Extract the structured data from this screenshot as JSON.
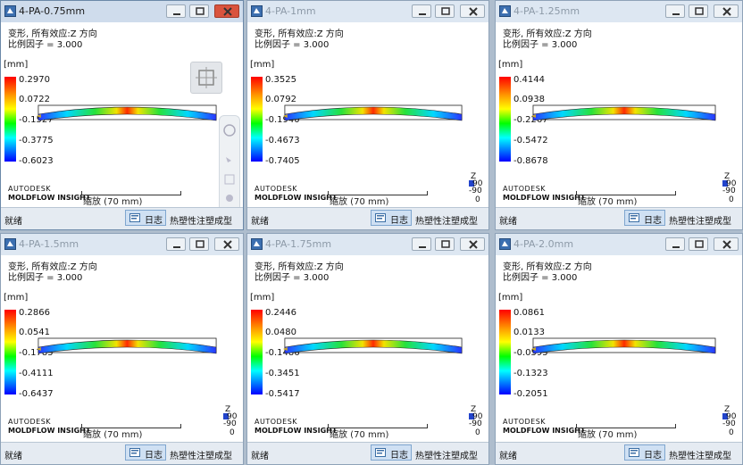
{
  "colors": {
    "accent": "#cfe0f3",
    "close_active": "#d9533d"
  },
  "icons": {
    "app": "moldflow-app-icon",
    "minimize": "minimize-icon",
    "maximize": "maximize-icon",
    "close": "close-icon",
    "log": "log-icon"
  },
  "common": {
    "title_line1": "变形, 所有效应:Z 方向",
    "title_line2": "比例因子 = 3.000",
    "unit": "[mm]",
    "brand_top": "AUTODESK",
    "brand_bottom": "MOLDFLOW INSIGHT",
    "scale_label": "缩放 (70 mm)",
    "axis_z": "Z",
    "axis_90": "90",
    "axis_m90": "-90",
    "axis_0": "0",
    "status": "就绪",
    "log_button": "日志",
    "product": "热塑性注塑成型"
  },
  "windows": [
    {
      "title": "4-PA-0.75mm",
      "active": true,
      "legend": [
        "0.2970",
        "0.0722",
        "-0.1527",
        "-0.3775",
        "-0.6023"
      ]
    },
    {
      "title": "4-PA-1mm",
      "active": false,
      "legend": [
        "0.3525",
        "0.0792",
        "-0.1940",
        "-0.4673",
        "-0.7405"
      ]
    },
    {
      "title": "4-PA-1.25mm",
      "active": false,
      "legend": [
        "0.4144",
        "0.0938",
        "-0.2267",
        "-0.5472",
        "-0.8678"
      ]
    },
    {
      "title": "4-PA-1.5mm",
      "active": false,
      "legend": [
        "0.2866",
        "0.0541",
        "-0.1785",
        "-0.4111",
        "-0.6437"
      ]
    },
    {
      "title": "4-PA-1.75mm",
      "active": false,
      "legend": [
        "0.2446",
        "0.0480",
        "-0.1486",
        "-0.3451",
        "-0.5417"
      ]
    },
    {
      "title": "4-PA-2.0mm",
      "active": false,
      "legend": [
        "0.0861",
        "0.0133",
        "-0.0595",
        "-0.1323",
        "-0.2051"
      ]
    }
  ]
}
